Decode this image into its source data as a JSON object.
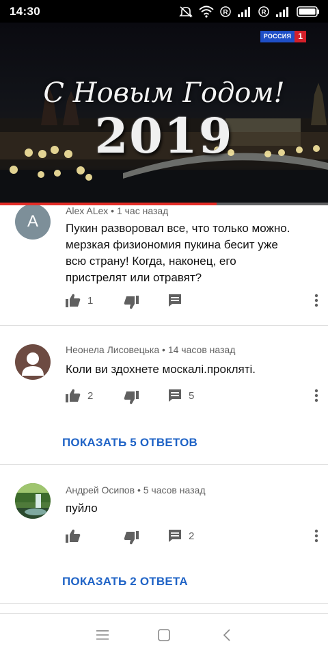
{
  "status_bar": {
    "time": "14:30",
    "icons": [
      "mute-icon",
      "wifi-icon",
      "roaming-r-icon",
      "signal-icon",
      "roaming-r-icon",
      "signal-icon",
      "battery-icon"
    ]
  },
  "video": {
    "channel_logo": {
      "name": "РОССИЯ",
      "number": "1",
      "colors": {
        "name_bg": "#1f4fc7",
        "number_bg": "#d4202a"
      }
    },
    "greeting": "С Новым Годом!",
    "year": "2019",
    "progress": 0.66,
    "progress_color": "#e52d27"
  },
  "comments": [
    {
      "author": "Alex ALex",
      "time": "1 час назад",
      "avatar_letter": "A",
      "text": "Пукин разворовал все, что только можно. мерзкая физиономия пукина бесит уже всю страну!  Когда, наконец, его пристрелят или отравят?",
      "likes": "1",
      "replies": "",
      "show_replies": ""
    },
    {
      "author": "Неонела Лисовецька",
      "time": "14 часов назад",
      "avatar_letter": "",
      "text": "Коли ви здохнете москалі.прокляті.",
      "likes": "2",
      "replies": "5",
      "show_replies": "ПОКАЗАТЬ 5 ОТВЕТОВ"
    },
    {
      "author": "Андрей Осипов",
      "time": "5 часов назад",
      "avatar_letter": "",
      "text": "пуйло",
      "likes": "",
      "replies": "2",
      "show_replies": "ПОКАЗАТЬ 2 ОТВЕТА"
    }
  ],
  "separator": "•",
  "colors": {
    "link": "#1f63c6",
    "meta": "#606060"
  },
  "nav_bar": {
    "buttons": [
      "menu-icon",
      "home-square-icon",
      "back-chevron-icon"
    ]
  }
}
